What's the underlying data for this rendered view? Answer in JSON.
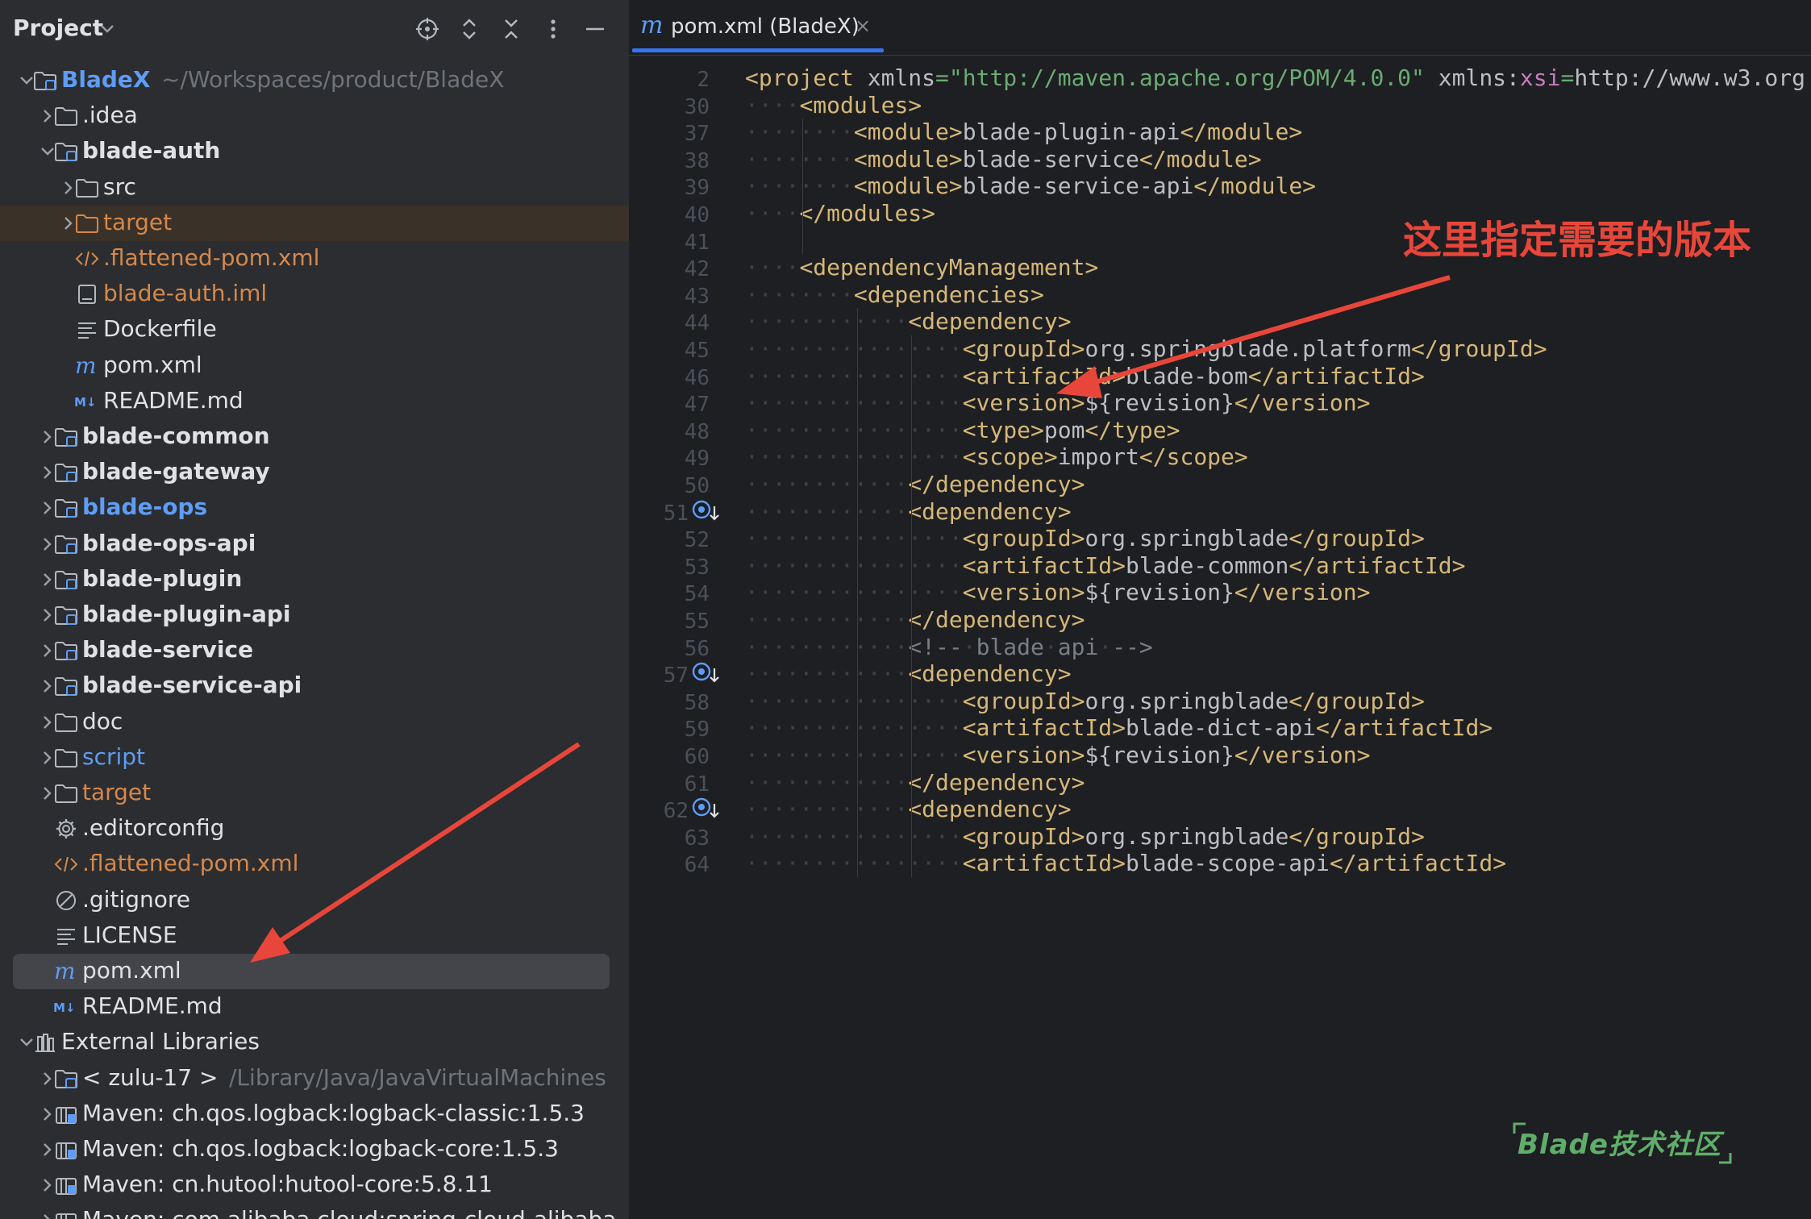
{
  "project_panel": {
    "title": "Project",
    "toolbar_icons": [
      "locate-icon",
      "expand-all-icon",
      "collapse-all-icon",
      "more-icon",
      "hide-icon"
    ],
    "tree": [
      {
        "label": "BladeX",
        "path": "~/Workspaces/product/BladeX",
        "icon": "module-folder-icon",
        "expanded": true
      },
      {
        "label": ".idea",
        "icon": "folder-icon",
        "expanded": false
      },
      {
        "label": "blade-auth",
        "icon": "module-folder-icon",
        "expanded": true
      },
      {
        "label": "src",
        "icon": "folder-icon",
        "expanded": false
      },
      {
        "label": "target",
        "icon": "excluded-folder-icon",
        "expanded": false
      },
      {
        "label": ".flattened-pom.xml",
        "icon": "xml-file-icon"
      },
      {
        "label": "blade-auth.iml",
        "icon": "iml-file-icon"
      },
      {
        "label": "Dockerfile",
        "icon": "text-file-icon"
      },
      {
        "label": "pom.xml",
        "icon": "maven-file-icon"
      },
      {
        "label": "README.md",
        "icon": "markdown-file-icon"
      },
      {
        "label": "blade-common",
        "icon": "module-folder-icon",
        "expanded": false
      },
      {
        "label": "blade-gateway",
        "icon": "module-folder-icon",
        "expanded": false
      },
      {
        "label": "blade-ops",
        "icon": "module-folder-icon",
        "expanded": false
      },
      {
        "label": "blade-ops-api",
        "icon": "module-folder-icon",
        "expanded": false
      },
      {
        "label": "blade-plugin",
        "icon": "module-folder-icon",
        "expanded": false
      },
      {
        "label": "blade-plugin-api",
        "icon": "module-folder-icon",
        "expanded": false
      },
      {
        "label": "blade-service",
        "icon": "module-folder-icon",
        "expanded": false
      },
      {
        "label": "blade-service-api",
        "icon": "module-folder-icon",
        "expanded": false
      },
      {
        "label": "doc",
        "icon": "folder-icon",
        "expanded": false
      },
      {
        "label": "script",
        "icon": "folder-icon",
        "expanded": false
      },
      {
        "label": "target",
        "icon": "folder-icon",
        "expanded": false
      },
      {
        "label": ".editorconfig",
        "icon": "gear-file-icon"
      },
      {
        "label": ".flattened-pom.xml",
        "icon": "xml-file-icon"
      },
      {
        "label": ".gitignore",
        "icon": "ignore-file-icon"
      },
      {
        "label": "LICENSE",
        "icon": "text-file-icon"
      },
      {
        "label": "pom.xml",
        "icon": "maven-file-icon",
        "selected": true
      },
      {
        "label": "README.md",
        "icon": "markdown-file-icon"
      },
      {
        "label": "External Libraries",
        "icon": "library-icon",
        "expanded": true
      },
      {
        "label": "< zulu-17 >",
        "path": "/Library/Java/JavaVirtualMachines",
        "icon": "jdk-icon",
        "expanded": false
      },
      {
        "label": "Maven: ch.qos.logback:logback-classic:1.5.3",
        "icon": "jar-icon",
        "expanded": false
      },
      {
        "label": "Maven: ch.qos.logback:logback-core:1.5.3",
        "icon": "jar-icon",
        "expanded": false
      },
      {
        "label": "Maven: cn.hutool:hutool-core:5.8.11",
        "icon": "jar-icon",
        "expanded": false
      },
      {
        "label": "Maven: com.alibaba.cloud:spring-cloud-alibaba",
        "icon": "jar-icon",
        "expanded": false
      }
    ]
  },
  "editor": {
    "tab": {
      "icon_glyph": "m",
      "label": "pom.xml (BladeX)",
      "close_glyph": "×"
    },
    "lines": [
      {
        "n": "2",
        "code": "<project xmlns=\"http://maven.apache.org/POM/4.0.0\" xmlns:xsi=\"http://www.w3.org"
      },
      {
        "n": "30",
        "code": "<modules>"
      },
      {
        "n": "37",
        "code": "<module>blade-plugin-api</module>"
      },
      {
        "n": "38",
        "code": "<module>blade-service</module>"
      },
      {
        "n": "39",
        "code": "<module>blade-service-api</module>"
      },
      {
        "n": "40",
        "code": "</modules>"
      },
      {
        "n": "41",
        "code": ""
      },
      {
        "n": "42",
        "code": "<dependencyManagement>"
      },
      {
        "n": "43",
        "code": "<dependencies>"
      },
      {
        "n": "44",
        "code": "<dependency>"
      },
      {
        "n": "45",
        "code": "<groupId>org.springblade.platform</groupId>"
      },
      {
        "n": "46",
        "code": "<artifactId>blade-bom</artifactId>"
      },
      {
        "n": "47",
        "code": "<version>${revision}</version>"
      },
      {
        "n": "48",
        "code": "<type>pom</type>"
      },
      {
        "n": "49",
        "code": "<scope>import</scope>"
      },
      {
        "n": "50",
        "code": "</dependency>"
      },
      {
        "n": "51",
        "code": "<dependency>"
      },
      {
        "n": "52",
        "code": "<groupId>org.springblade</groupId>"
      },
      {
        "n": "53",
        "code": "<artifactId>blade-common</artifactId>"
      },
      {
        "n": "54",
        "code": "<version>${revision}</version>"
      },
      {
        "n": "55",
        "code": "</dependency>"
      },
      {
        "n": "56",
        "code": "<!-- blade api -->"
      },
      {
        "n": "57",
        "code": "<dependency>"
      },
      {
        "n": "58",
        "code": "<groupId>org.springblade</groupId>"
      },
      {
        "n": "59",
        "code": "<artifactId>blade-dict-api</artifactId>"
      },
      {
        "n": "60",
        "code": "<version>${revision}</version>"
      },
      {
        "n": "61",
        "code": "</dependency>"
      },
      {
        "n": "62",
        "code": "<dependency>"
      },
      {
        "n": "63",
        "code": "<groupId>org.springblade</groupId>"
      },
      {
        "n": "64",
        "code": "<artifactId>blade-scope-api</artifactId>"
      }
    ],
    "gutter_icons": [
      "maven-dependency-icon",
      "maven-dependency-icon",
      "maven-dependency-icon"
    ]
  },
  "annotation": {
    "text": "这里指定需要的版本",
    "color": "#e8463a"
  },
  "watermark": {
    "text": "Blade技术社区"
  },
  "colors": {
    "tag": "#d5b778",
    "string": "#6aab73",
    "namespace": "#c77dbb",
    "comment": "#7a7e85",
    "text": "#bcbec4",
    "accent": "#3574f0",
    "arrow": "#e8463a",
    "panel_bg": "#2b2d30",
    "editor_bg": "#1e1f22"
  }
}
